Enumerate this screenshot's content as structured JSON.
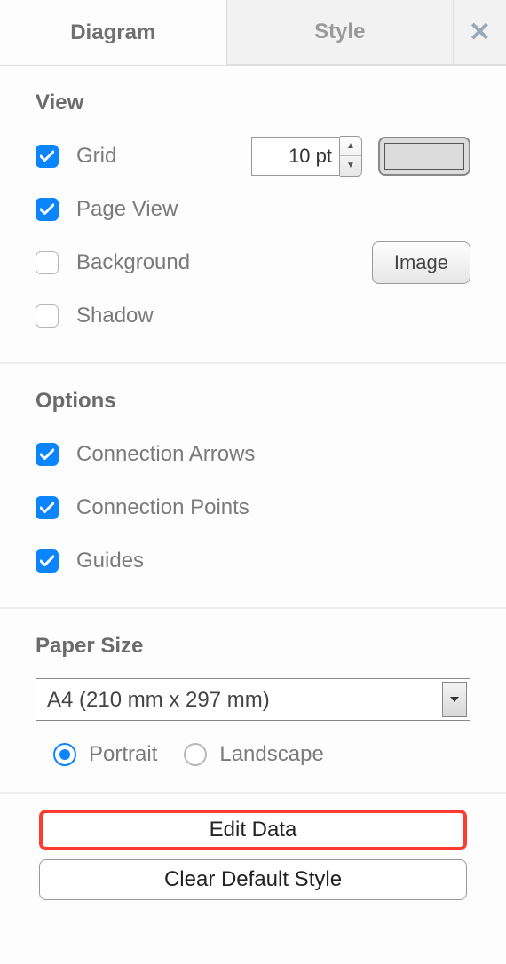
{
  "tabs": {
    "diagram": "Diagram",
    "style": "Style"
  },
  "view": {
    "heading": "View",
    "grid_label": "Grid",
    "grid_checked": true,
    "grid_value": "10 pt",
    "pageview_label": "Page View",
    "pageview_checked": true,
    "background_label": "Background",
    "background_checked": false,
    "background_button": "Image",
    "shadow_label": "Shadow",
    "shadow_checked": false
  },
  "options": {
    "heading": "Options",
    "conn_arrows_label": "Connection Arrows",
    "conn_arrows_checked": true,
    "conn_points_label": "Connection Points",
    "conn_points_checked": true,
    "guides_label": "Guides",
    "guides_checked": true
  },
  "paper": {
    "heading": "Paper Size",
    "selected": "A4 (210 mm x 297 mm)",
    "portrait_label": "Portrait",
    "landscape_label": "Landscape",
    "orientation": "portrait"
  },
  "buttons": {
    "edit_data": "Edit Data",
    "clear_style": "Clear Default Style"
  }
}
